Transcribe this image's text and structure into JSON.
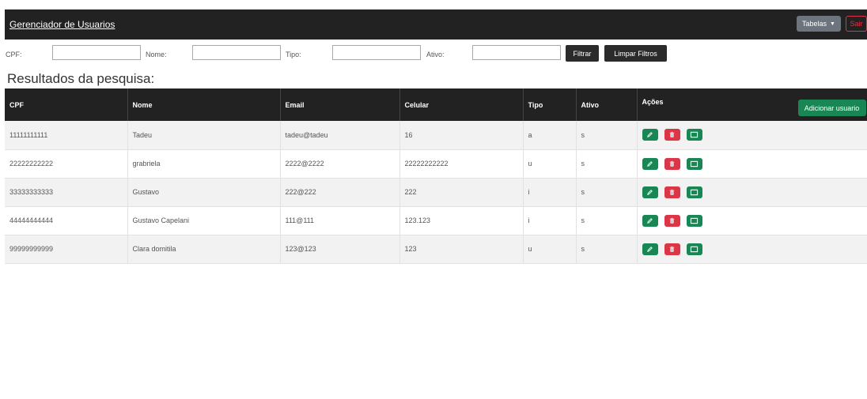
{
  "navbar": {
    "brand": "Gerenciador de Usuarios",
    "tables_button": "Tabelas",
    "logout_button": "Sair"
  },
  "filters": {
    "cpf_label": "CPF:",
    "cpf_value": "",
    "nome_label": "Nome:",
    "nome_value": "",
    "tipo_label": "Tipo:",
    "tipo_value": "",
    "ativo_label": "Ativo:",
    "ativo_value": "",
    "filter_button": "Filtrar",
    "clear_button": "Limpar Filtros"
  },
  "results": {
    "title": "Resultados da pesquisa:",
    "add_button": "Adicionar usuario",
    "columns": [
      "CPF",
      "Nome",
      "Email",
      "Celular",
      "Tipo",
      "Ativo",
      "Ações"
    ],
    "rows": [
      {
        "cpf": "11111111111",
        "nome": "Tadeu",
        "email": "tadeu@tadeu",
        "celular": "16",
        "tipo": "a",
        "ativo": "s"
      },
      {
        "cpf": "22222222222",
        "nome": "grabriela",
        "email": "2222@2222",
        "celular": "22222222222",
        "tipo": "u",
        "ativo": "s"
      },
      {
        "cpf": "33333333333",
        "nome": "Gustavo",
        "email": "222@222",
        "celular": "222",
        "tipo": "i",
        "ativo": "s"
      },
      {
        "cpf": "44444444444",
        "nome": "Gustavo Capelani",
        "email": "111@111",
        "celular": "123.123",
        "tipo": "i",
        "ativo": "s"
      },
      {
        "cpf": "99999999999",
        "nome": "Clara domitila",
        "email": "123@123",
        "celular": "123",
        "tipo": "u",
        "ativo": "s"
      }
    ]
  },
  "action_icons": [
    "pencil-icon",
    "trash-icon",
    "window-icon"
  ],
  "colors": {
    "navbar": "#222222",
    "success": "#198754",
    "danger": "#dc3545",
    "secondary": "#6c757d"
  }
}
